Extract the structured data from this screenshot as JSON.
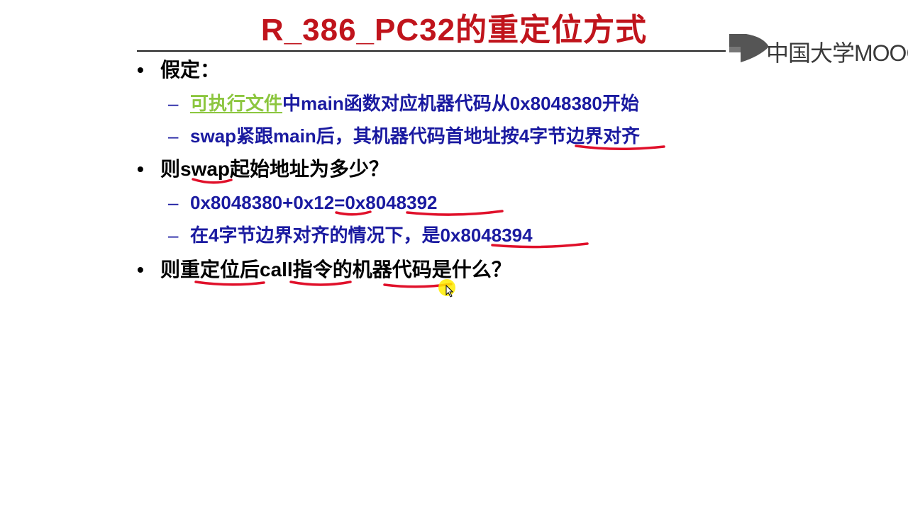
{
  "slide": {
    "title": "R_386_PC32的重定位方式",
    "logo_text": "中国大学MOOC",
    "bullets": [
      {
        "text": "假定："
      },
      {
        "text": "则swap起始地址为多少？"
      },
      {
        "text": "则重定位后call指令的机器代码是什么？"
      }
    ],
    "assumptions": {
      "line1_highlight": "可执行文件",
      "line1_rest": "中main函数对应机器代码从0x8048380开始",
      "line2": "swap紧跟main后，其机器代码首地址按4字节边界对齐"
    },
    "answers": {
      "line1": "0x8048380+0x12=0x8048392",
      "line2": "在4字节边界对齐的情况下，是0x8048394"
    }
  },
  "colors": {
    "title": "#c0141c",
    "sub_text": "#1a1aa0",
    "highlight": "#8cc63f",
    "annotation": "#e0102a",
    "cursor": "#ffec00"
  }
}
